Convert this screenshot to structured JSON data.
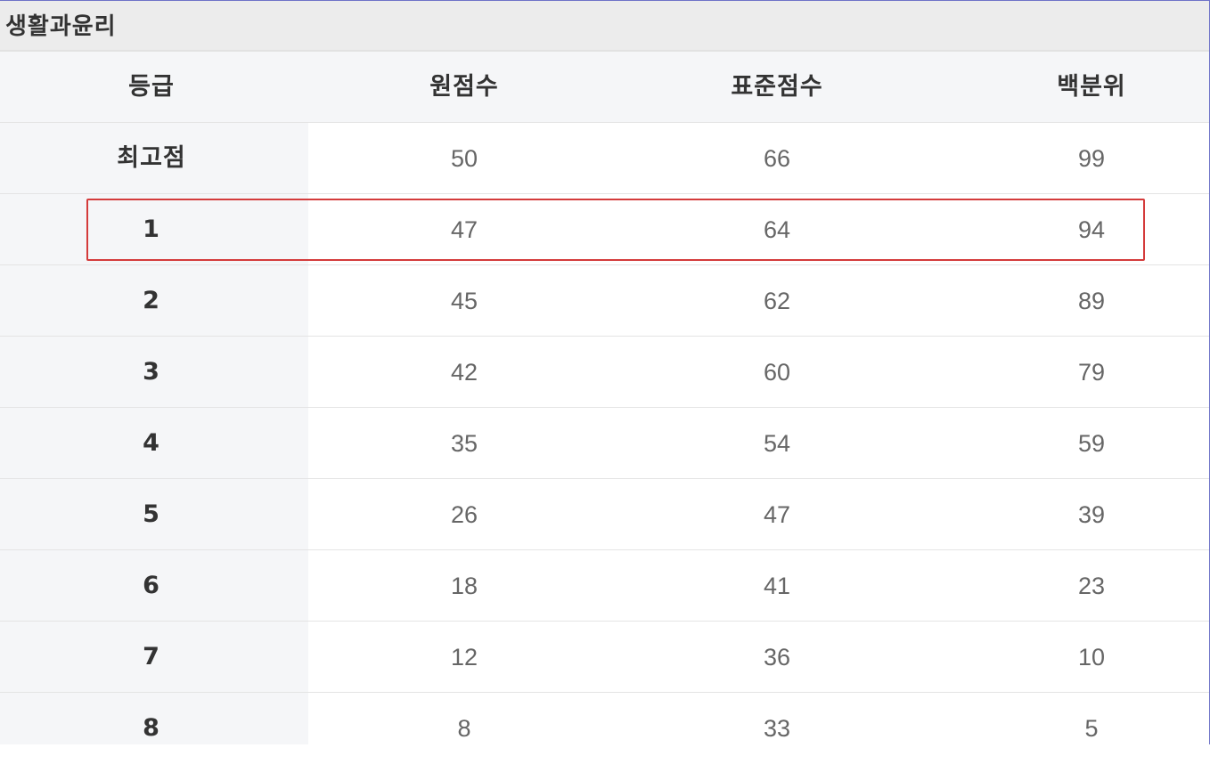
{
  "section": {
    "title": "생활과윤리"
  },
  "table": {
    "headers": [
      "등급",
      "원점수",
      "표준점수",
      "백분위"
    ],
    "rows": [
      {
        "grade": "최고점",
        "raw": "50",
        "standard": "66",
        "percentile": "99"
      },
      {
        "grade": "1",
        "raw": "47",
        "standard": "64",
        "percentile": "94"
      },
      {
        "grade": "2",
        "raw": "45",
        "standard": "62",
        "percentile": "89"
      },
      {
        "grade": "3",
        "raw": "42",
        "standard": "60",
        "percentile": "79"
      },
      {
        "grade": "4",
        "raw": "35",
        "standard": "54",
        "percentile": "59"
      },
      {
        "grade": "5",
        "raw": "26",
        "standard": "47",
        "percentile": "39"
      },
      {
        "grade": "6",
        "raw": "18",
        "standard": "41",
        "percentile": "23"
      },
      {
        "grade": "7",
        "raw": "12",
        "standard": "36",
        "percentile": "10"
      },
      {
        "grade": "8",
        "raw": "8",
        "standard": "33",
        "percentile": "5"
      }
    ],
    "highlighted_row_grade": "1"
  },
  "colors": {
    "highlight_border": "#d43b3b",
    "header_background": "#f5f6f8",
    "title_background": "#ececec"
  }
}
